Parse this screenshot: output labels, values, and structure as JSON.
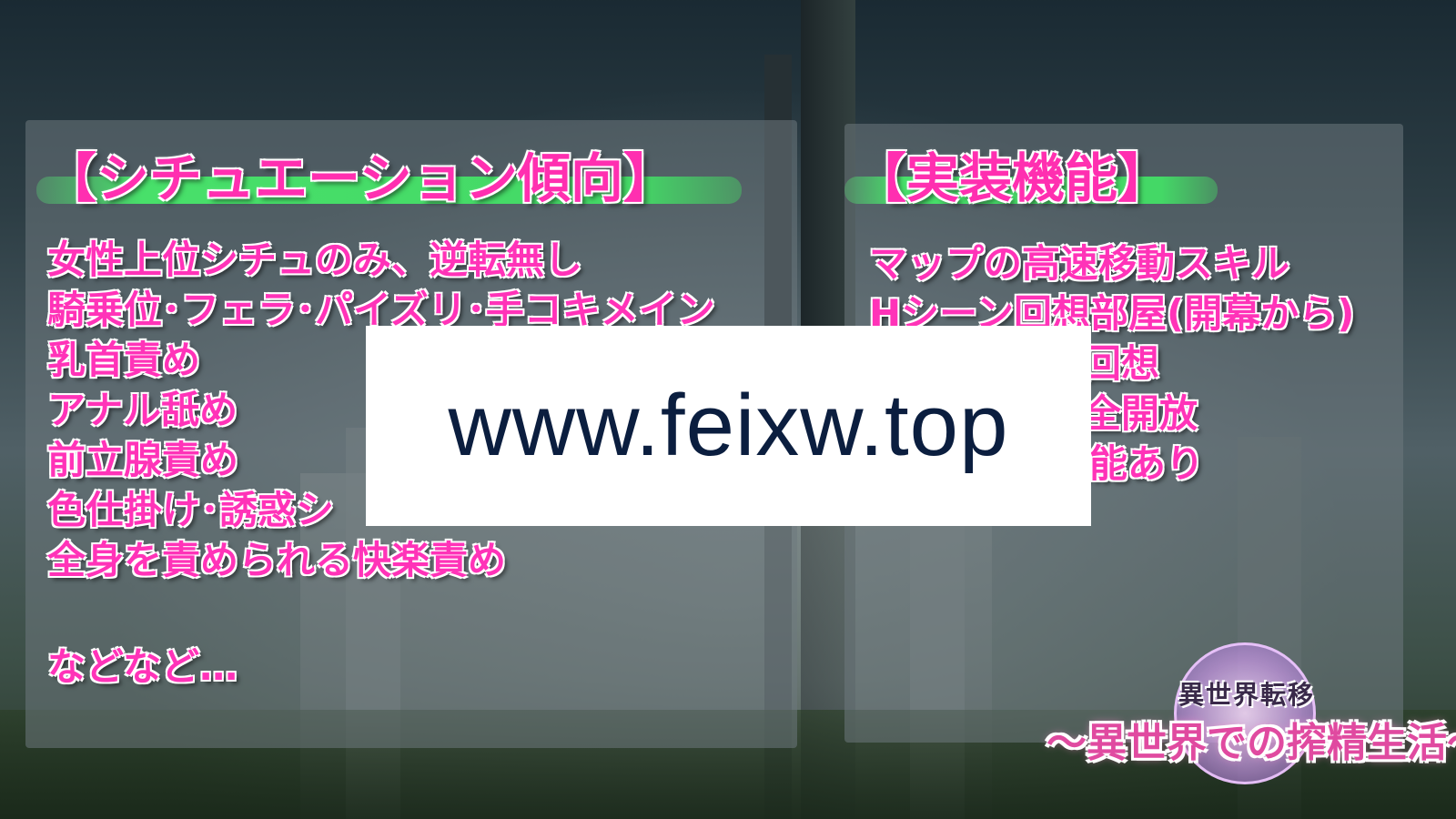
{
  "left_panel": {
    "heading": "【シチュエーション傾向】",
    "items": [
      "女性上位シチュのみ、逆転無し",
      "騎乗位･フェラ･パイズリ･手コキメイン",
      "乳首責め",
      "アナル舐め",
      "前立腺責め",
      "色仕掛け･誘惑シ",
      "全身を責められる快楽責め"
    ],
    "footer": "などなど…"
  },
  "right_panel": {
    "heading": "【実装機能】",
    "items": [
      "マップの高速移動スキル",
      "Hシーン回想部屋(開幕から)",
      "回想",
      "全開放",
      "機能あり"
    ]
  },
  "watermark": {
    "text": "www.feixw.top"
  },
  "logo": {
    "subtitle": "異世界転移",
    "title": "〜異世界での搾精生活〜"
  },
  "colors": {
    "heading_pink": "#ff2fb0",
    "highlight_green": "#48e06a",
    "watermark_text": "#0b1e3f"
  }
}
